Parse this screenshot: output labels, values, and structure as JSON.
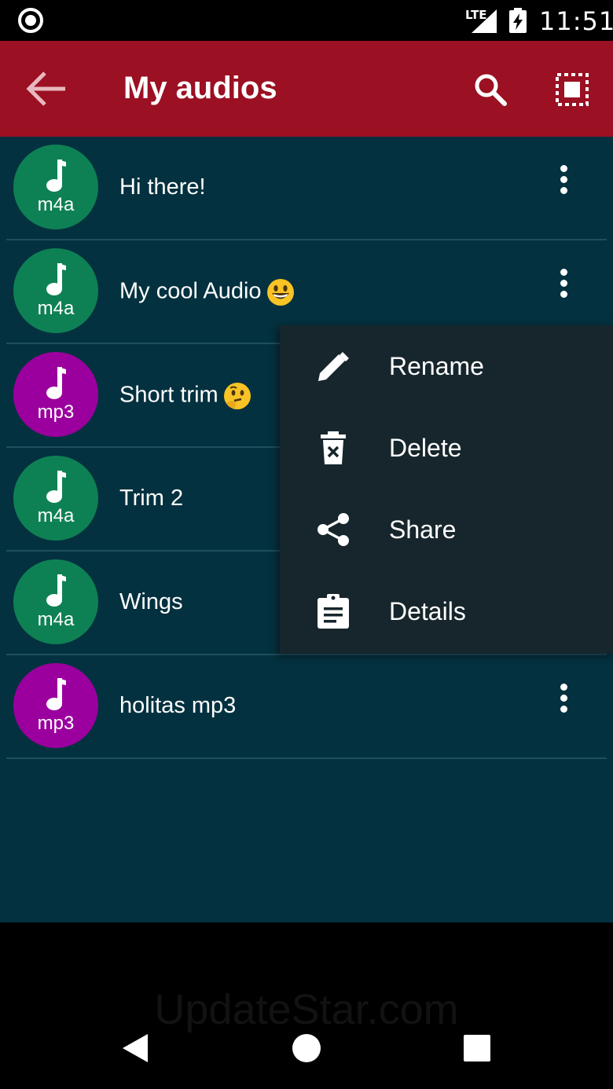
{
  "status_bar": {
    "network": "LTE",
    "time": "11:51"
  },
  "app_bar": {
    "title": "My audios"
  },
  "audios": [
    {
      "title": "Hi there!",
      "ext": "m4a",
      "color": "#0e8154"
    },
    {
      "title": "My cool Audio",
      "ext": "m4a",
      "color": "#0e8154"
    },
    {
      "title": "Short trim",
      "ext": "mp3",
      "color": "#9b009e"
    },
    {
      "title": "Trim 2",
      "ext": "m4a",
      "color": "#0e8154"
    },
    {
      "title": "Wings",
      "ext": "m4a",
      "color": "#0e8154"
    },
    {
      "title": "holitas mp3",
      "ext": "mp3",
      "color": "#9b009e"
    }
  ],
  "menu": {
    "rename": "Rename",
    "delete": "Delete",
    "share": "Share",
    "details": "Details"
  },
  "watermark": "UpdateStar.com",
  "colors": {
    "app_bar": "#9b1022",
    "background": "#04313f",
    "menu": "#17262d"
  }
}
